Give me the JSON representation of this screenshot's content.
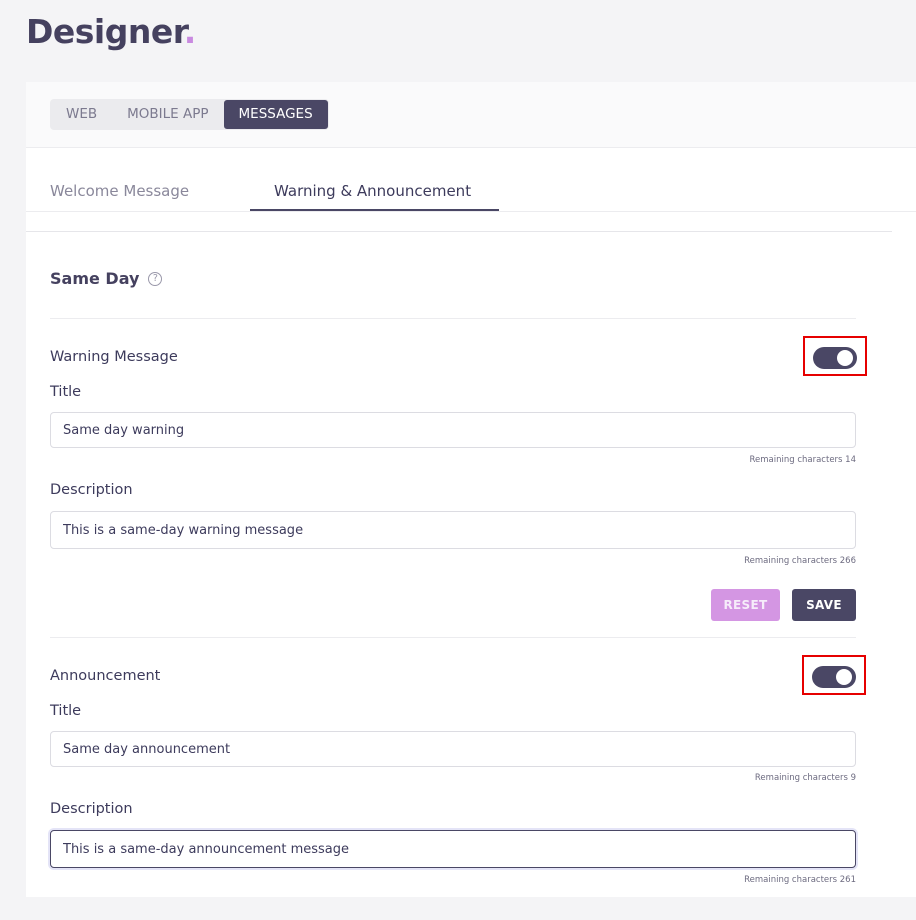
{
  "app": {
    "title": "Designer",
    "title_dot": ".",
    "accent_color": "#c98ae0",
    "primary_color": "#4a4765"
  },
  "platform_tabs": [
    {
      "label": "WEB",
      "active": false
    },
    {
      "label": "MOBILE APP",
      "active": false
    },
    {
      "label": "MESSAGES",
      "active": true
    }
  ],
  "message_tabs": [
    {
      "label": "Welcome Message",
      "active": false
    },
    {
      "label": "Warning & Announcement",
      "active": true
    }
  ],
  "section": {
    "title": "Same Day",
    "help_icon": "question-circle-icon"
  },
  "warning": {
    "label": "Warning Message",
    "enabled": true,
    "title_label": "Title",
    "title_value": "Same day warning",
    "title_remaining": "Remaining characters 14",
    "description_label": "Description",
    "description_value": "This is a same-day warning message",
    "description_remaining": "Remaining characters 266",
    "reset_label": "RESET",
    "save_label": "SAVE"
  },
  "announcement": {
    "label": "Announcement",
    "enabled": true,
    "title_label": "Title",
    "title_value": "Same day announcement",
    "title_remaining": "Remaining characters 9",
    "description_label": "Description",
    "description_value": "This is a same-day announcement message",
    "description_remaining": "Remaining characters 261"
  }
}
